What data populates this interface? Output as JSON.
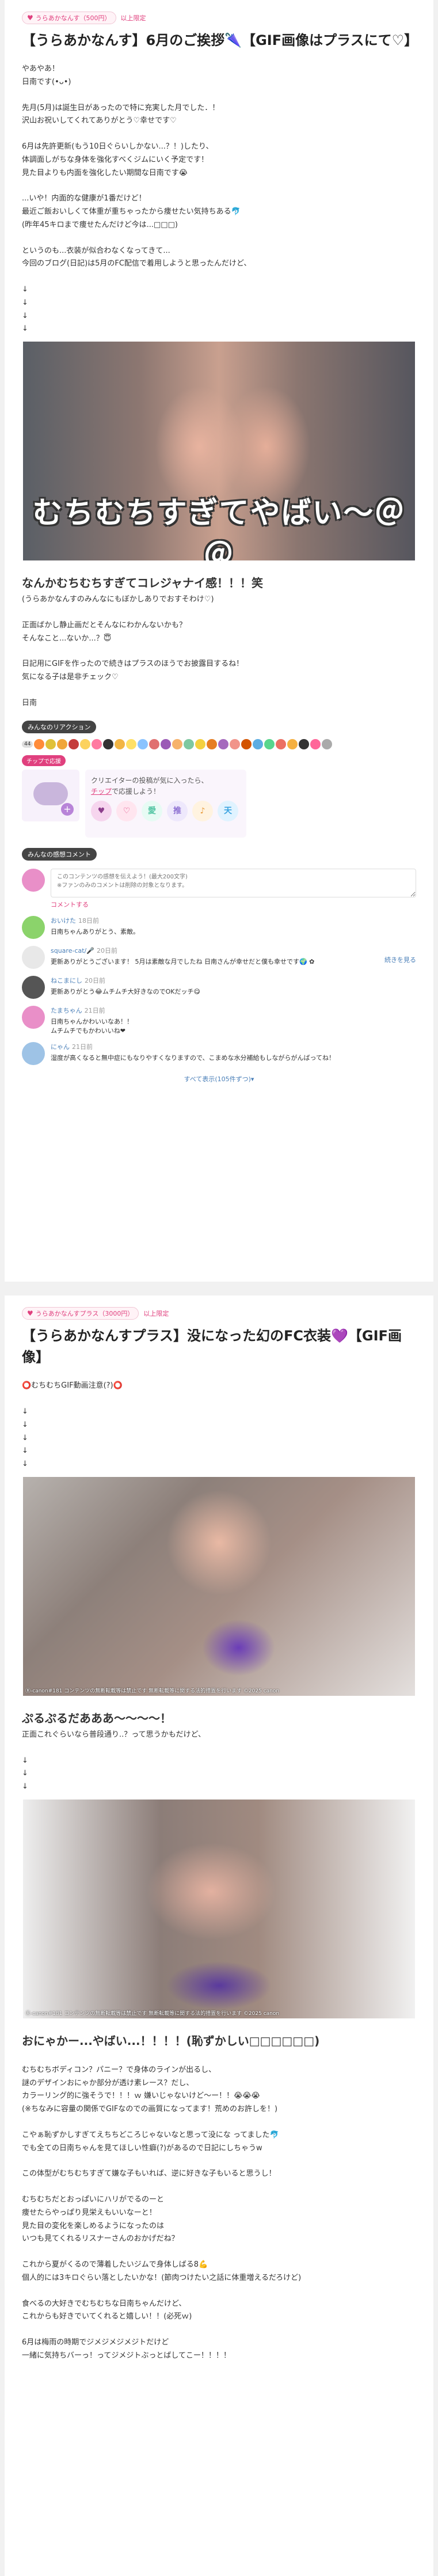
{
  "post1": {
    "plan_badge": "うらあかなんす（500円）",
    "plan_suffix": "以上限定",
    "title": "【うらあかなんす】6月のご挨拶🌂【GIF画像はプラスにて♡】",
    "body_lines": [
      "やあやあ！",
      "日南です(•ᴗ•)",
      "",
      "先月(5月)は誕生日があったので特に充実した月でした．！",
      "沢山お祝いしてくれてありがとう♡幸せです♡",
      "",
      "6月は先許更新(もう10日ぐらいしかない...？！)したり、",
      "体調面しがちな身体を強化すべくジムにいく予定です！",
      "見た目よりも内面を強化したい期間な日南です😭",
      "",
      "...いや！内面的な健康が1番だけど！",
      "最近ご飯おいしくて体重が重ちゃったから痩せたい気持ちある🐬",
      "(昨年45キロまで痩せたんだけど今は...□□□)",
      "",
      "というのも...衣装が似合わなくなってきて...",
      "今回のブログ(日記)は5月のFC配信で着用しようと思ったんだけど、",
      "",
      "↓",
      "↓",
      "↓",
      "↓"
    ],
    "image_overlay": "むちむちすぎてやばい〜＠＠",
    "subtitle": "なんかむちむちすぎてコレジャナイ感！！！笑",
    "subtitle_note": "(うらあかなんすのみんなにもぼかしありでおすそわけ♡)",
    "body2_lines": [
      "正面ばかし静止画だとそんなにわかんないかも？",
      "そんなこと...ないか...？😇",
      "",
      "日記用にGIFを作ったので続きはプラスのほうでお披露目するね！",
      "気になる子は是非チェック♡",
      "",
      "日南"
    ],
    "reactions_label": "みんなのリアクション",
    "reaction_count": "44",
    "support_label": "チップで応援",
    "support_text_1": "クリエイターの投稿が気に入ったら、",
    "support_link": "チップ",
    "support_text_2": "で応援しよう！",
    "comments_label": "みんなの感想コメント",
    "comment_placeholder": "このコンテンツの感想を伝えよう！(最大200文字)\n※ファンのみのコメントは削除の対象となります。",
    "comment_submit": "コメントする",
    "comments": [
      {
        "name": "おいけた",
        "time": "18日前",
        "text": "日南ちゃんありがとう、素敵。",
        "color": "#8bd36b"
      },
      {
        "name": "square-cat/🎤",
        "time": "20日前",
        "text": "更新ありがとうございます！ 5月は素敵な月でしたね 日南さんが幸せだと僕も幸せです🌍 ✿",
        "more": "続きを見る",
        "color": "#e8e8e8"
      },
      {
        "name": "ねこまにし",
        "time": "20日前",
        "text": "更新ありがとう😂ムチムチ大好きなのでOKだッチ😋",
        "color": "#555555"
      },
      {
        "name": "たまちゃん",
        "time": "21日前",
        "text": "日南ちゃんかわいいなあ！！\nムチムチでもかわいいね❤",
        "color": "#e98fc8"
      },
      {
        "name": "にゃん",
        "time": "21日前",
        "text": "湿度が高くなると無中症にもなりやすくなりますので、こまめな水分補給もしながらがんばってね！",
        "color": "#9ec3e6"
      }
    ],
    "show_all": "すべて表示(105件ずつ)▾"
  },
  "post2": {
    "plan_badge": "うらあかなんすプラス（3000円）",
    "plan_suffix": "以上限定",
    "title": "【うらあかなんすプラス】没になった幻のFC衣装💜【GIF画像】",
    "alert": "⭕️むちむちGIF動画注意(?)⭕️",
    "arrows": [
      "↓",
      "↓",
      "↓",
      "↓",
      "↓"
    ],
    "image1_caption": "Ⓡ-canon#181 コンテンツの無断転載等は禁止です 無断転載等に関する法的措置を行います ©2025 canon",
    "subtitle1": "ぷるぷるだあああ〜〜〜〜！",
    "subtitle1_note": "正面これぐらいなら普段通り..？って思うかもだけど、",
    "arrows2": [
      "↓",
      "↓",
      "↓"
    ],
    "image2_caption": "Ⓡ-canon#181 コンテンツの無断転載等は禁止です 無断転載等に関する法的措置を行います ©2025 canon",
    "subtitle2": "おにゃかー...やばい...！！！！(恥ずかしい□□□□□□)",
    "body_lines": [
      "むちむちボディコン？パニー？で身体のラインが出るし、",
      "謎のデザインおにゃか部分が透け素レース？だし、",
      "カラーリング的に強そうで！！！ｗ 嫌いじゃないけど〜ー！！😭😭😭",
      "(※ちなみに容量の関係でGIFなのでの画質になってます！荒めのお許しを！)",
      "",
      "こやぁ恥ずかしすぎてえちちどころじゃないなと思って没にな ってました🐬",
      "でも全ての日南ちゃんを見てほしい性癖(?)があるので日記にしちゃうw",
      "",
      "この体型がむちむちすぎて嫌な子もいれば、逆に好きな子もいると思うし！",
      "",
      "むちむちだとおっぱいにハリがでるのーと",
      "痩せたらやっぱり見栄えもいいなーと！",
      "見た目の変化を楽しめるようになったのは",
      "いつも見てくれるリスナーさんのおかげだね？",
      "",
      "これから夏がくるので薄着したいジムで身体しばる8💪",
      "個人的には3キロぐらい落としたいかな！(節肉つけたい之話に体重増えるだろけど)",
      "",
      "食べるの大好きでむちむちな日南ちゃんだけど、",
      "これからも好きでいてくれると嬉しい！！(必死ｗ)",
      "",
      "6月は梅雨の時期でジメジメジメジトだけど",
      "一緒に気持ちバーっ！ってジメジトぶっとばしてこー！！！！"
    ]
  },
  "icons": {
    "heart": "♥",
    "reaction_set": [
      "#ff8c3a",
      "#e0c13a",
      "#f0a63a",
      "#c43c3c",
      "#fcd25f",
      "#ff7aa0",
      "#333333",
      "#f2b544",
      "#ffe066",
      "#8ac3ff",
      "#e07070",
      "#9b59b6",
      "#f6b26b",
      "#7ec8a0",
      "#f4d03f",
      "#e67e22",
      "#a569bd",
      "#f1948a",
      "#d35400",
      "#5dade2",
      "#58d68d",
      "#ec7063",
      "#f5b041",
      "#333333",
      "#ff6699",
      "#aaaaaa"
    ],
    "stamps": [
      {
        "label": "♥",
        "color": "#8c3e8c",
        "bg": "#f6d5ee"
      },
      {
        "label": "♡",
        "color": "#e0407e",
        "bg": "#ffe5ef"
      },
      {
        "label": "愛",
        "color": "#4fc3a1",
        "bg": "#e7fbf4"
      },
      {
        "label": "推",
        "color": "#8c6fd1",
        "bg": "#eee8fc"
      },
      {
        "label": "♪",
        "color": "#e89a3a",
        "bg": "#fff3e0"
      },
      {
        "label": "天",
        "color": "#3aa3e0",
        "bg": "#e0f3ff"
      }
    ]
  }
}
